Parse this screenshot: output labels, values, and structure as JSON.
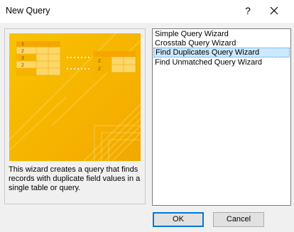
{
  "window": {
    "title": "New Query",
    "help_label": "?"
  },
  "description": "This wizard creates a query that finds records with duplicate field values in a single table or query.",
  "wizards": [
    {
      "label": "Simple Query Wizard",
      "selected": false
    },
    {
      "label": "Crosstab Query Wizard",
      "selected": false
    },
    {
      "label": "Find Duplicates Query Wizard",
      "selected": true
    },
    {
      "label": "Find Unmatched Query Wizard",
      "selected": false
    }
  ],
  "preview": {
    "left_table_numbers": [
      "1",
      "2",
      "3",
      "2"
    ],
    "right_table_numbers": [
      "2",
      "2"
    ],
    "colors": {
      "background": "#f5b400",
      "table_header": "#f7a600",
      "table_cell": "#fbd868",
      "dots": "#ffffff"
    }
  },
  "buttons": {
    "ok": "OK",
    "cancel": "Cancel"
  }
}
